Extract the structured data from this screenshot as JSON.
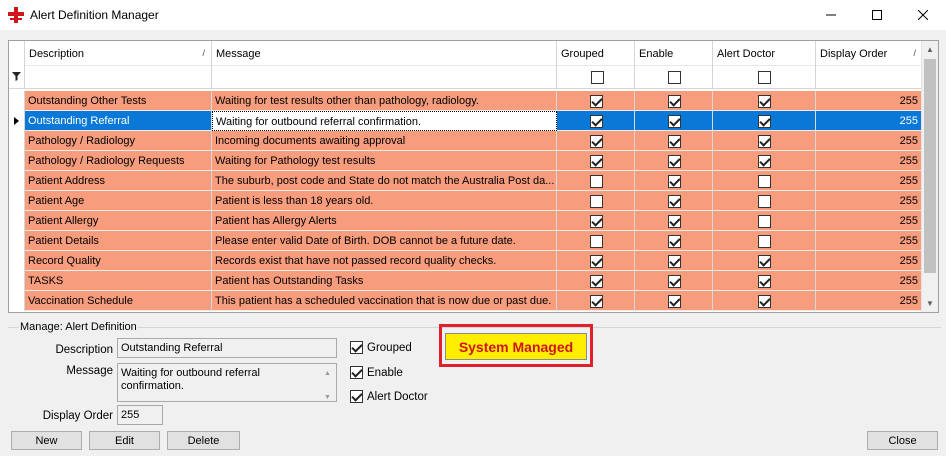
{
  "window": {
    "title": "Alert Definition Manager",
    "minimize_label": "",
    "maximize_label": "",
    "close_label": ""
  },
  "grid": {
    "columns": {
      "description": "Description",
      "message": "Message",
      "grouped": "Grouped",
      "enable": "Enable",
      "alert_doctor": "Alert Doctor",
      "display_order": "Display Order"
    },
    "selected_index": 1,
    "rows": [
      {
        "description": "Outstanding Other Tests",
        "message": "Waiting for test results other than pathology, radiology.",
        "grouped": true,
        "enable": true,
        "alert_doctor": true,
        "display_order": "255"
      },
      {
        "description": "Outstanding Referral",
        "message": "Waiting for outbound referral confirmation.",
        "grouped": true,
        "enable": true,
        "alert_doctor": true,
        "display_order": "255"
      },
      {
        "description": "Pathology / Radiology",
        "message": "Incoming documents awaiting approval",
        "grouped": true,
        "enable": true,
        "alert_doctor": true,
        "display_order": "255"
      },
      {
        "description": "Pathology / Radiology  Requests",
        "message": "Waiting for Pathology test results",
        "grouped": true,
        "enable": true,
        "alert_doctor": true,
        "display_order": "255"
      },
      {
        "description": "Patient Address",
        "message": "The suburb, post code and State do not match the Australia Post da...",
        "grouped": false,
        "enable": true,
        "alert_doctor": false,
        "display_order": "255"
      },
      {
        "description": "Patient Age",
        "message": "Patient is less than 18 years old.",
        "grouped": false,
        "enable": true,
        "alert_doctor": false,
        "display_order": "255"
      },
      {
        "description": "Patient Allergy",
        "message": "Patient has Allergy Alerts",
        "grouped": true,
        "enable": true,
        "alert_doctor": false,
        "display_order": "255"
      },
      {
        "description": "Patient Details",
        "message": "Please enter valid Date of Birth.  DOB cannot be a future date.",
        "grouped": false,
        "enable": true,
        "alert_doctor": false,
        "display_order": "255"
      },
      {
        "description": "Record Quality",
        "message": "Records exist that have not passed record quality checks.",
        "grouped": true,
        "enable": true,
        "alert_doctor": true,
        "display_order": "255"
      },
      {
        "description": "TASKS",
        "message": "Patient has Outstanding Tasks",
        "grouped": true,
        "enable": true,
        "alert_doctor": true,
        "display_order": "255"
      },
      {
        "description": "Vaccination Schedule",
        "message": "This patient has a scheduled vaccination that is now due or past due.",
        "grouped": true,
        "enable": true,
        "alert_doctor": true,
        "display_order": "255"
      }
    ]
  },
  "manage": {
    "title": "Manage: Alert Definition",
    "description_label": "Description",
    "description_value": "Outstanding Referral",
    "message_label": "Message",
    "message_value": "Waiting for outbound referral confirmation.",
    "display_order_label": "Display Order",
    "display_order_value": "255",
    "grouped_label": "Grouped",
    "grouped_checked": true,
    "enable_label": "Enable",
    "enable_checked": true,
    "alert_doctor_label": "Alert Doctor",
    "alert_doctor_checked": true,
    "system_managed_label": "System Managed"
  },
  "buttons": {
    "new": "New",
    "edit": "Edit",
    "delete": "Delete",
    "close": "Close"
  },
  "colors": {
    "row_highlight": "#f79c7c",
    "selection": "#0a78d7",
    "system_managed_bg": "#ffee00",
    "system_managed_text": "#d0141c",
    "frame_red": "#e0202a"
  },
  "icons": {
    "app": "red-cross-icon",
    "filter": "funnel-icon",
    "row_indicator": "triangle-right-icon"
  }
}
